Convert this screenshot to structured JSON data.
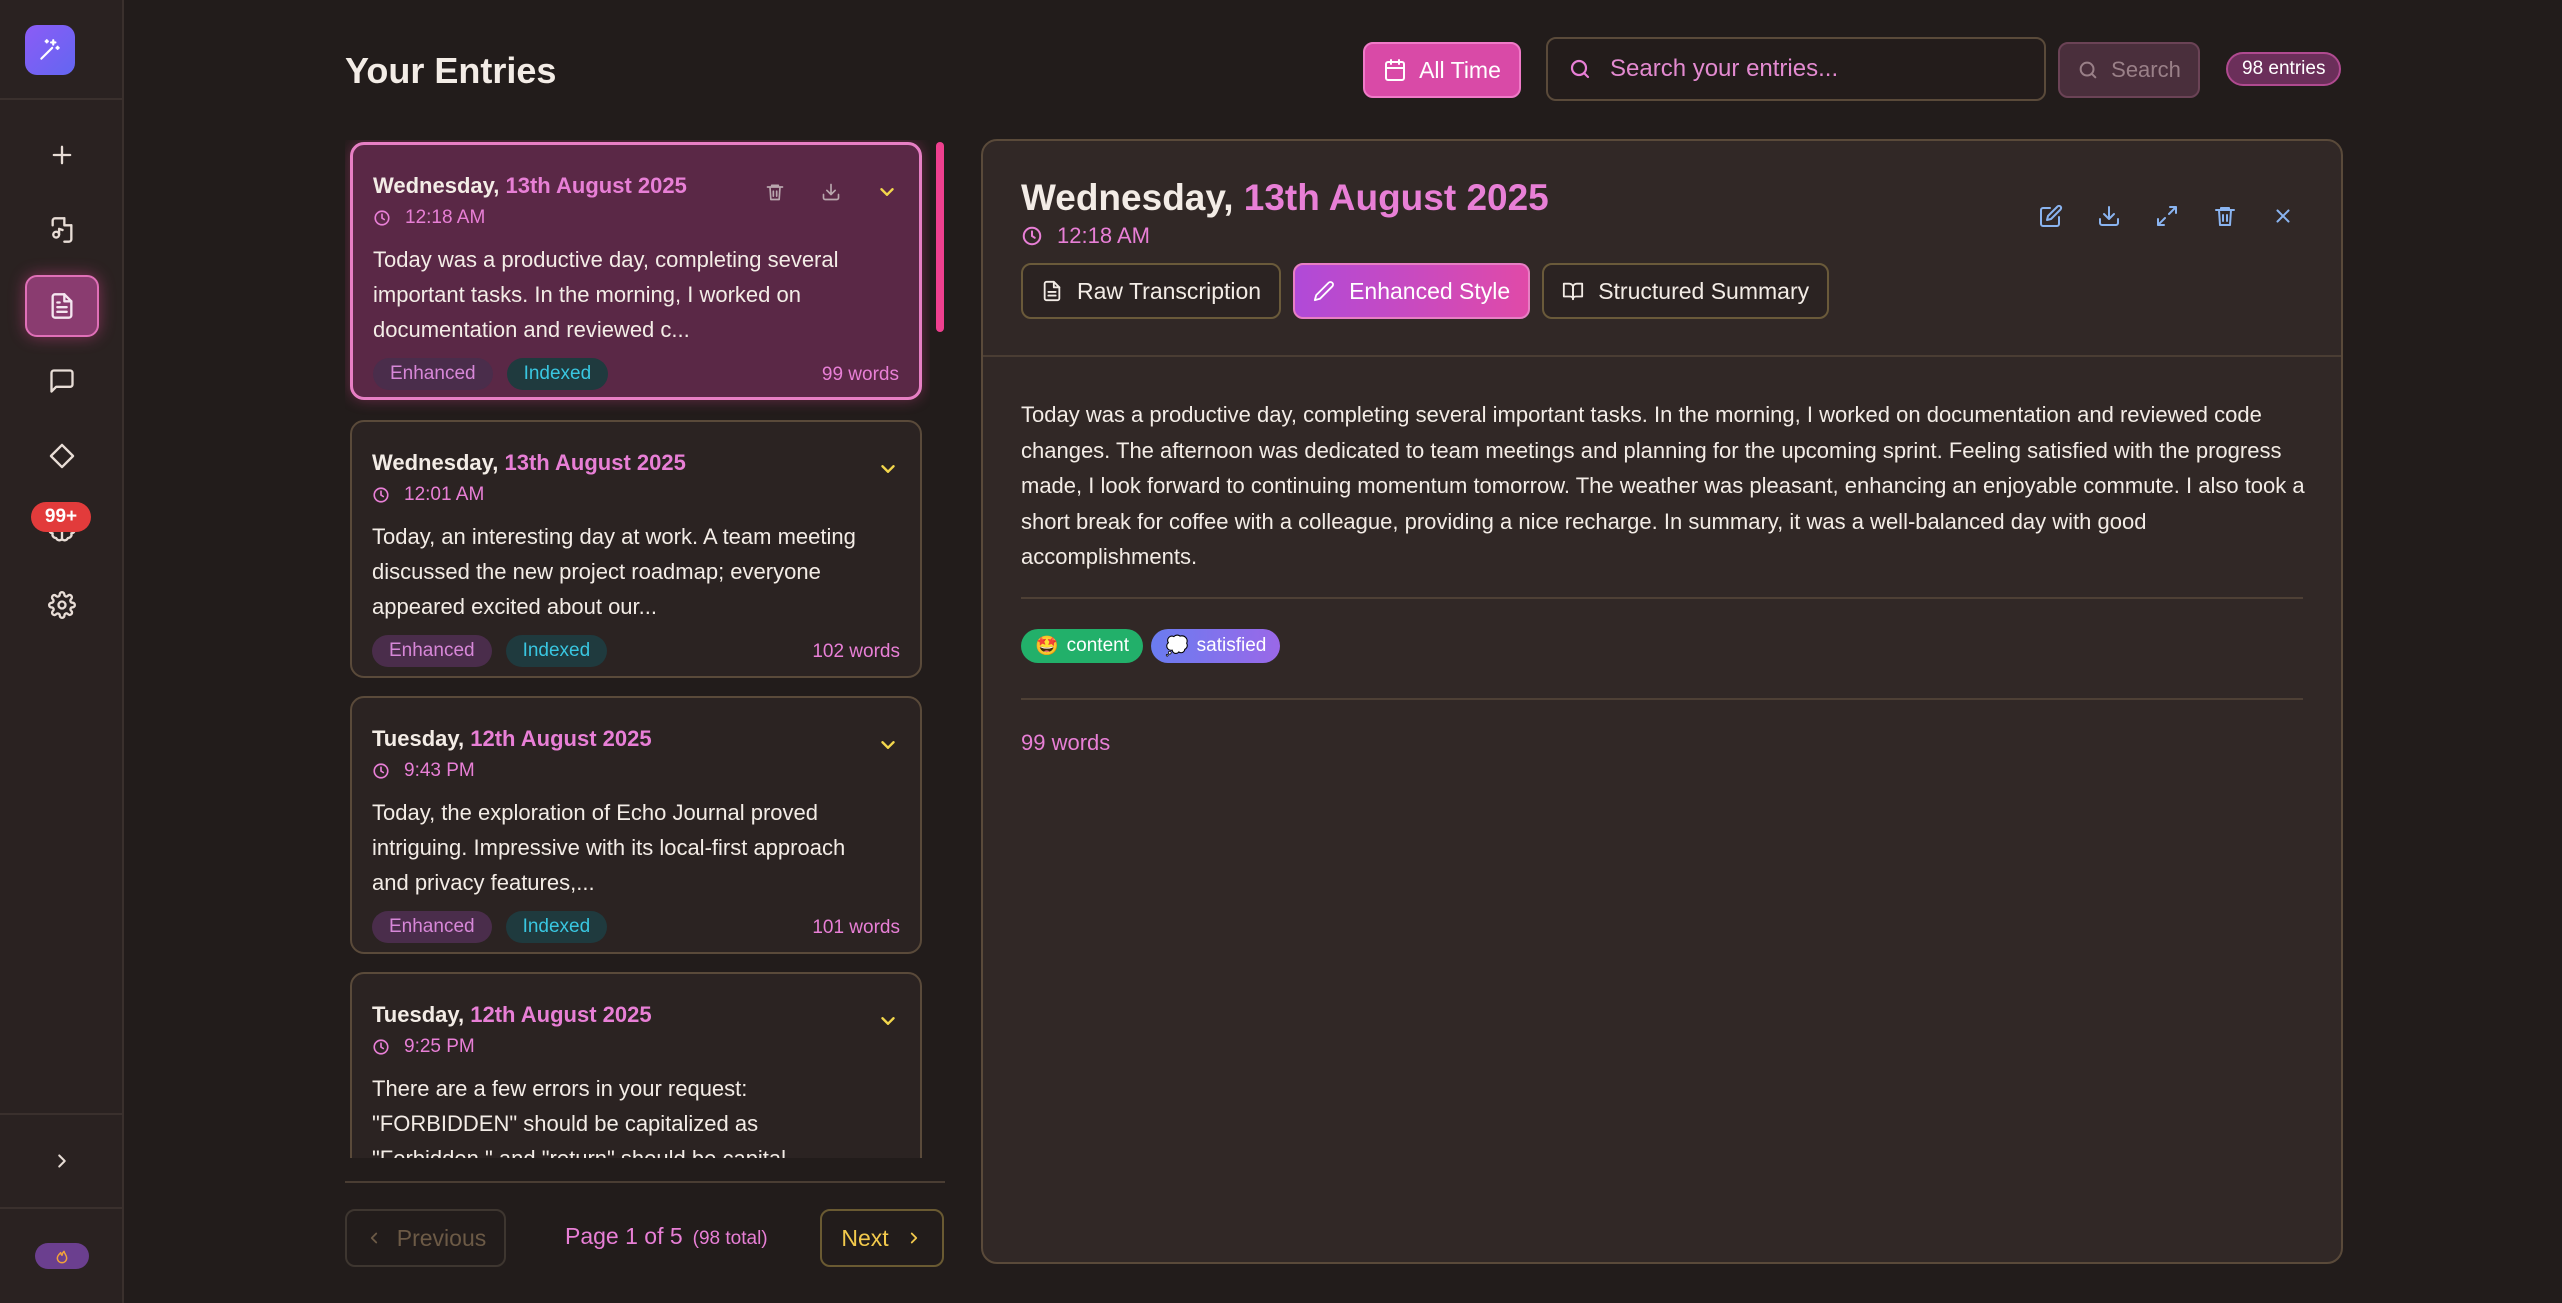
{
  "sidebar": {
    "logo_icon": "sparkles-icon",
    "items": [
      {
        "name": "new-entry",
        "icon": "plus-icon"
      },
      {
        "name": "import-audio",
        "icon": "file-audio-icon"
      },
      {
        "name": "entries",
        "icon": "document-icon",
        "active": true
      },
      {
        "name": "chat",
        "icon": "chat-bubble-icon"
      },
      {
        "name": "tags",
        "icon": "diamond-icon"
      },
      {
        "name": "insights",
        "icon": "brain-icon",
        "badge": "99+"
      },
      {
        "name": "settings",
        "icon": "gear-icon"
      }
    ],
    "expand_icon": "chevron-right-icon",
    "streak_icon": "flame-icon"
  },
  "header": {
    "title": "Your Entries",
    "filter_label": "All Time",
    "search_placeholder": "Search your entries...",
    "search_button": "Search",
    "entries_count": "98 entries"
  },
  "entries": [
    {
      "weekday": "Wednesday,",
      "date": "13th August 2025",
      "time": "12:18 AM",
      "preview": "Today was a productive day, completing several important tasks. In the morning, I worked on documentation and reviewed c...",
      "tags": [
        "Enhanced",
        "Indexed"
      ],
      "words": "99 words",
      "selected": true
    },
    {
      "weekday": "Wednesday,",
      "date": "13th August 2025",
      "time": "12:01 AM",
      "preview": "Today, an interesting day at work. A team meeting discussed the new project roadmap; everyone appeared excited about our...",
      "tags": [
        "Enhanced",
        "Indexed"
      ],
      "words": "102 words"
    },
    {
      "weekday": "Tuesday,",
      "date": "12th August 2025",
      "time": "9:43 PM",
      "preview": "Today, the exploration of Echo Journal proved intriguing. Impressive with its local-first approach and privacy features,...",
      "tags": [
        "Enhanced",
        "Indexed"
      ],
      "words": "101 words"
    },
    {
      "weekday": "Tuesday,",
      "date": "12th August 2025",
      "time": "9:25 PM",
      "preview": "There are a few errors in your request: \"FORBIDDEN\" should be capitalized as \"Forbidden,\" and \"return\" should be capital...",
      "tags": [],
      "words": ""
    }
  ],
  "pagination": {
    "previous": "Previous",
    "page": "Page 1 of 5",
    "total": "(98 total)",
    "next": "Next"
  },
  "detail": {
    "weekday": "Wednesday,",
    "date": "13th August 2025",
    "time": "12:18 AM",
    "tabs": [
      {
        "label": "Raw Transcription",
        "icon": "file-text-icon"
      },
      {
        "label": "Enhanced Style",
        "icon": "pencil-icon",
        "active": true
      },
      {
        "label": "Structured Summary",
        "icon": "book-open-icon"
      }
    ],
    "body": "Today was a productive day, completing several important tasks. In the morning, I worked on documentation and reviewed code changes. The afternoon was dedicated to team meetings and planning for the upcoming sprint. Feeling satisfied with the progress made, I look forward to continuing momentum tomorrow. The weather was pleasant, enhancing an enjoyable commute. I also took a short break for coffee with a colleague, providing a nice recharge. In summary, it was a well-balanced day with good accomplishments.",
    "moods": [
      {
        "emoji": "🤩",
        "label": "content"
      },
      {
        "emoji": "💭",
        "label": "satisfied"
      }
    ],
    "words": "99 words"
  },
  "colors": {
    "accent_pink": "#e87fd6",
    "accent_yellow": "#f2c94c",
    "background": "#221c1b"
  }
}
